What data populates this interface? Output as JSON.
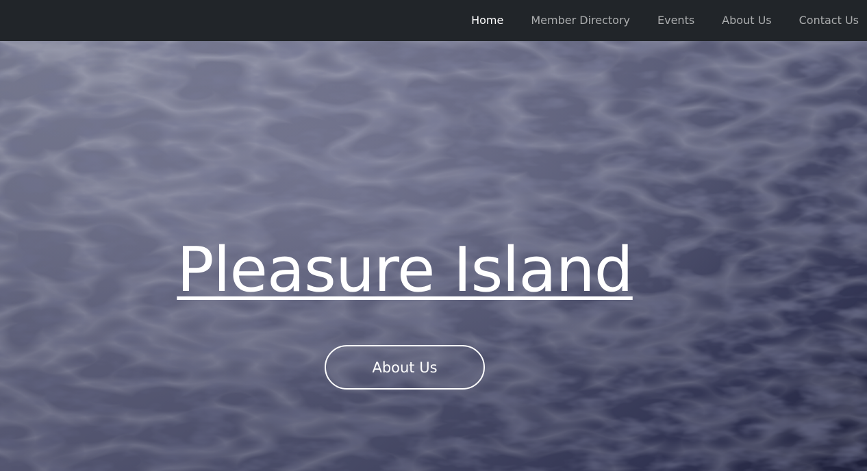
{
  "nav": {
    "items": [
      {
        "label": "Home",
        "active": true
      },
      {
        "label": "Member Directory",
        "active": false
      },
      {
        "label": "Events",
        "active": false
      },
      {
        "label": "About Us",
        "active": false
      },
      {
        "label": "Contact Us",
        "active": false
      }
    ]
  },
  "hero": {
    "title": "Pleasure Island",
    "button_label": "About Us"
  },
  "colors": {
    "navbar_bg": "#212529",
    "nav_active": "#ffffff",
    "nav_inactive": "#9a9ca0",
    "hero_text": "#ffffff"
  }
}
